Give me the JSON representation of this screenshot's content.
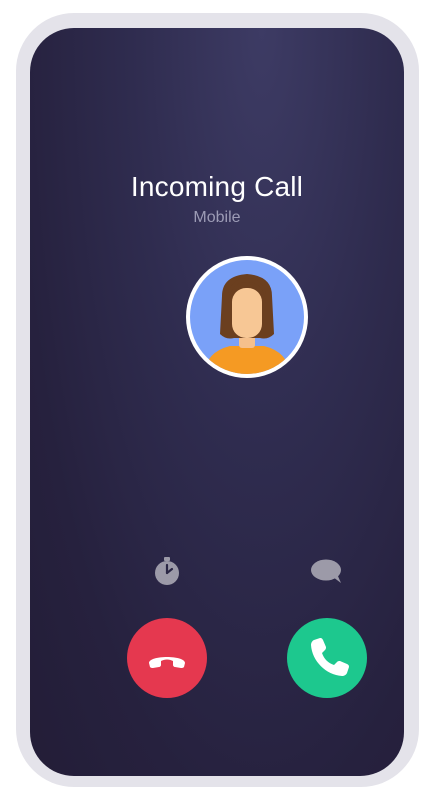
{
  "call": {
    "title": "Incoming Call",
    "subtitle": "Mobile"
  },
  "icons": {
    "timer": "stopwatch-icon",
    "message": "message-bubble-icon",
    "decline": "phone-hangup-icon",
    "accept": "phone-icon"
  },
  "colors": {
    "screen_background": "#2a2646",
    "frame": "#e4e3ea",
    "decline": "#e5384f",
    "accept": "#1dc88e",
    "secondary_text": "#9c9bb5",
    "small_icons": "#9c9aa8"
  }
}
